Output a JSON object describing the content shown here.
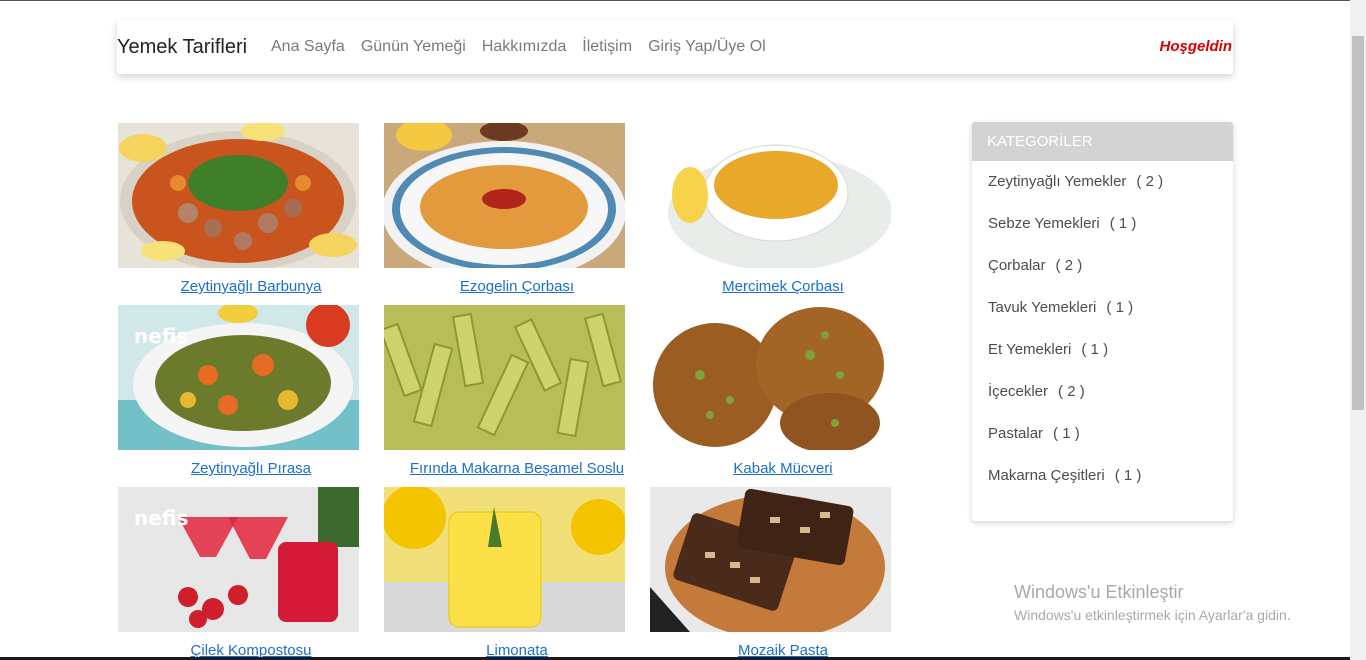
{
  "navbar": {
    "brand": "Yemek Tarifleri",
    "links": [
      "Ana Sayfa",
      "Günün Yemeği",
      "Hakkımızda",
      "İletişim",
      "Giriş Yap/Üye Ol"
    ],
    "welcome": "Hoşgeldin"
  },
  "recipes": [
    {
      "title": "Zeytinyağlı Barbunya"
    },
    {
      "title": "Ezogelin Çorbası"
    },
    {
      "title": "Mercimek Çorbası"
    },
    {
      "title": "Zeytinyağlı Pırasa"
    },
    {
      "title": "Fırında Makarna Beşamel Soslu"
    },
    {
      "title": "Kabak Mücveri"
    },
    {
      "title": "Çilek Kompostosu"
    },
    {
      "title": "Limonata"
    },
    {
      "title": "Mozaik Pasta"
    }
  ],
  "sidebar": {
    "title": "KATEGORİLER",
    "categories": [
      {
        "name": "Zeytinyağlı Yemekler",
        "count": "( 2 )"
      },
      {
        "name": "Sebze Yemekleri",
        "count": "( 1 )"
      },
      {
        "name": "Çorbalar",
        "count": "( 2 )"
      },
      {
        "name": "Tavuk Yemekleri",
        "count": "( 1 )"
      },
      {
        "name": "Et Yemekleri",
        "count": "( 1 )"
      },
      {
        "name": "İçecekler",
        "count": "( 2 )"
      },
      {
        "name": "Pastalar",
        "count": "( 1 )"
      },
      {
        "name": "Makarna Çeşitleri",
        "count": "( 1 )"
      }
    ]
  },
  "watermark": {
    "title": "Windows'u Etkinleştir",
    "subtitle": "Windows'u etkinleştirmek için Ayarlar'a gidin."
  }
}
